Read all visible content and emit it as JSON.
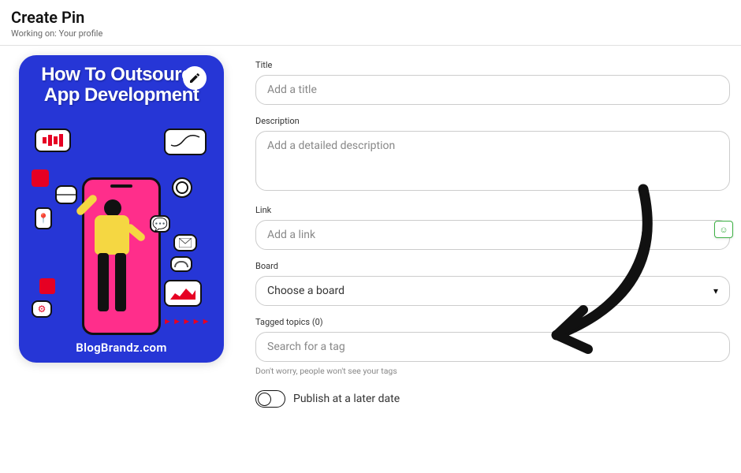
{
  "header": {
    "title": "Create Pin",
    "sub_prefix": "Working on:",
    "sub_value": "Your profile"
  },
  "preview": {
    "title_line1": "How To Outsource",
    "title_line2": "App Development",
    "footer": "BlogBrandz.com"
  },
  "form": {
    "title": {
      "label": "Title",
      "placeholder": "Add a title",
      "value": ""
    },
    "description": {
      "label": "Description",
      "placeholder": "Add a detailed description",
      "value": ""
    },
    "link": {
      "label": "Link",
      "placeholder": "Add a link",
      "value": ""
    },
    "board": {
      "label": "Board",
      "placeholder": "Choose a board"
    },
    "tags": {
      "label": "Tagged topics (0)",
      "placeholder": "Search for a tag",
      "hint": "Don't worry, people won't see your tags"
    },
    "publish_later": {
      "label": "Publish at a later date"
    }
  }
}
